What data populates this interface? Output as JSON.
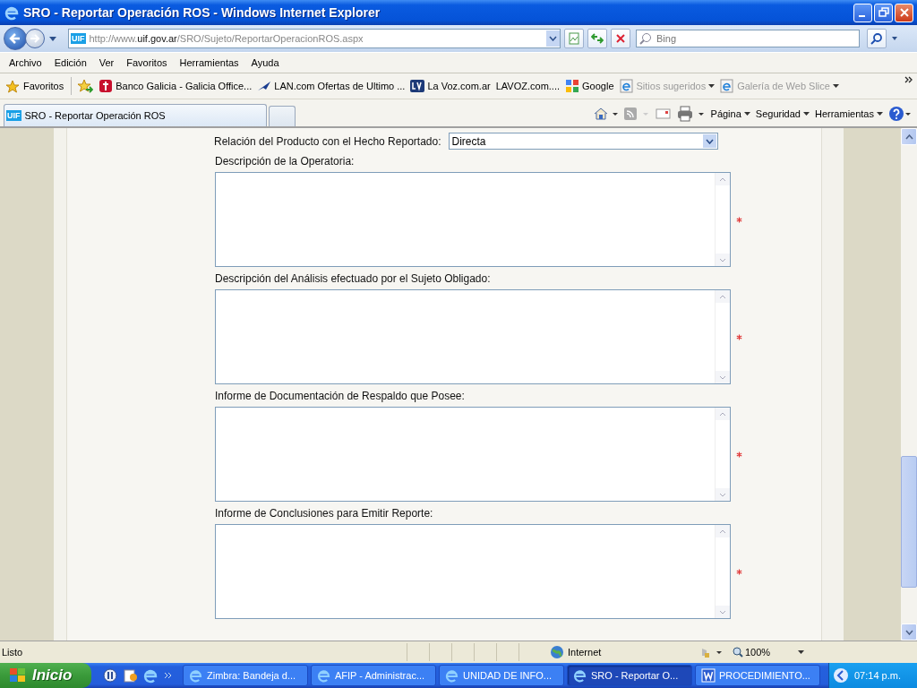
{
  "window": {
    "title": "SRO - Reportar Operación ROS - Windows Internet Explorer"
  },
  "address_bar": {
    "site_logo": "UIF",
    "url_prefix": "http://www.",
    "url_host": "uif.gov.ar",
    "url_path": "/SRO/Sujeto/ReportarOperacionROS.aspx"
  },
  "search": {
    "placeholder": "Bing"
  },
  "menu": [
    "Archivo",
    "Edición",
    "Ver",
    "Favoritos",
    "Herramientas",
    "Ayuda"
  ],
  "favorites_bar": {
    "label": "Favoritos",
    "links": [
      {
        "kind": "galicia",
        "label": "Banco Galicia - Galicia Office...",
        "disabled": false,
        "dropdown": false
      },
      {
        "kind": "plane",
        "label": "LAN.com Ofertas de Ultimo ...",
        "disabled": false,
        "dropdown": false
      },
      {
        "kind": "lv",
        "label": "La Voz.com.ar",
        "disabled": false,
        "dropdown": false
      },
      {
        "kind": "plain",
        "label": "LAVOZ.com....",
        "disabled": false,
        "dropdown": false
      },
      {
        "kind": "google",
        "label": "Google",
        "disabled": false,
        "dropdown": false
      },
      {
        "kind": "ie",
        "label": "Sitios sugeridos",
        "disabled": true,
        "dropdown": true
      },
      {
        "kind": "ie",
        "label": "Galería de Web Slice",
        "disabled": true,
        "dropdown": true
      }
    ]
  },
  "tab": {
    "logo": "UIF",
    "title": "SRO - Reportar Operación ROS"
  },
  "command_bar": [
    "Página",
    "Seguridad",
    "Herramientas"
  ],
  "form": {
    "select_label": "Relación del Producto con el Hecho Reportado:",
    "select_value": "Directa",
    "textareas": [
      {
        "label": "Descripción de la Operatoria:",
        "required": true
      },
      {
        "label": "Descripción del Análisis efectuado por el Sujeto Obligado:",
        "required": true
      },
      {
        "label": "Informe de Documentación de Respaldo que Posee:",
        "required": true
      },
      {
        "label": "Informe de Conclusiones para Emitir Reporte:",
        "required": true
      }
    ]
  },
  "status_bar": {
    "text": "Listo",
    "zone": "Internet",
    "zoom": "100%"
  },
  "taskbar": {
    "start": "Inicio",
    "tasks": [
      {
        "kind": "ie",
        "label": "Zimbra: Bandeja d...",
        "selected": false
      },
      {
        "kind": "ie",
        "label": "AFIP - Administrac...",
        "selected": false
      },
      {
        "kind": "ie",
        "label": "UNIDAD DE INFO...",
        "selected": false
      },
      {
        "kind": "ie",
        "label": "SRO - Reportar O...",
        "selected": true
      },
      {
        "kind": "word",
        "label": "PROCEDIMIENTO...",
        "selected": false
      }
    ],
    "clock": "07:14 p.m."
  }
}
